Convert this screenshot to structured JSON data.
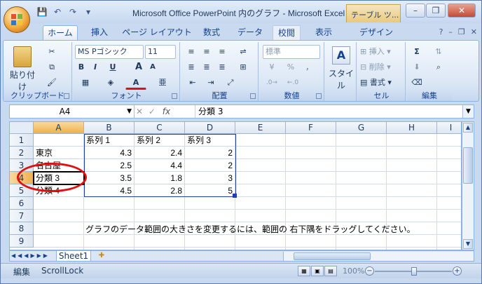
{
  "window": {
    "title": "Microsoft Office PowerPoint 内のグラフ - Microsoft Excel",
    "context_tab": "テーブル ツ..."
  },
  "qat": {
    "save_icon": "💾",
    "undo_icon": "↶",
    "redo_icon": "↷"
  },
  "tabs": [
    {
      "label": "ホーム"
    },
    {
      "label": "挿入"
    },
    {
      "label": "ページ レイアウト"
    },
    {
      "label": "数式"
    },
    {
      "label": "データ"
    },
    {
      "label": "校閲"
    },
    {
      "label": "表示"
    },
    {
      "label": "デザイン"
    }
  ],
  "ribbon": {
    "clipboard": {
      "label": "クリップボード",
      "paste": "貼り付け"
    },
    "font": {
      "label": "フォント",
      "name": "MS Pゴシック",
      "size": "11",
      "bold": "B",
      "italic": "I",
      "underline": "U",
      "grow": "A",
      "shrink": "A",
      "color_a": "A"
    },
    "alignment": {
      "label": "配置"
    },
    "number": {
      "label": "数値",
      "format": "標準",
      "percent": "%",
      "comma": ","
    },
    "style": {
      "label": "スタイル",
      "icon": "A"
    },
    "cells": {
      "label": "セル",
      "insert": "挿入",
      "delete": "削除",
      "format": "書式"
    },
    "editing": {
      "label": "編集",
      "sigma": "Σ"
    }
  },
  "formula": {
    "name_box": "A4",
    "fx": "fx",
    "value": "分類 3"
  },
  "columns": [
    "A",
    "B",
    "C",
    "D",
    "E",
    "F",
    "G",
    "H",
    "I"
  ],
  "rows": [
    "1",
    "2",
    "3",
    "4",
    "5",
    "6",
    "7",
    "8",
    "9"
  ],
  "table": {
    "headers": [
      "",
      "系列 1",
      "系列 2",
      "系列 3"
    ],
    "data": [
      [
        "東京",
        "4.3",
        "2.4",
        "2"
      ],
      [
        "名古屋",
        "2.5",
        "4.4",
        "2"
      ],
      [
        "分類 3",
        "3.5",
        "1.8",
        "3"
      ],
      [
        "分類 4",
        "4.5",
        "2.8",
        "5"
      ]
    ]
  },
  "note": "グラフのデータ範囲の大きさを変更するには、範囲の 右下隅をドラッグしてください。",
  "sheet_tab": "Sheet1",
  "status": {
    "mode": "編集",
    "scroll_lock": "ScrollLock",
    "zoom": "100%"
  },
  "colors": {
    "selection_highlight": "#f1b04d",
    "annotation_circle": "#e01010",
    "table_border": "#1f3fb0"
  }
}
